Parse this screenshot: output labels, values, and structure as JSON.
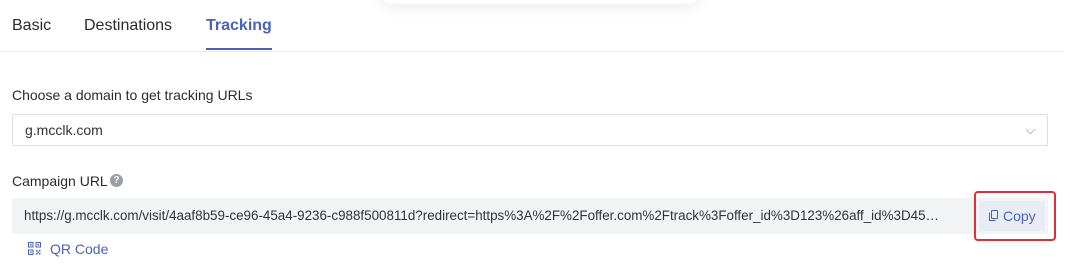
{
  "tabs": [
    {
      "label": "Basic",
      "active": false
    },
    {
      "label": "Destinations",
      "active": false
    },
    {
      "label": "Tracking",
      "active": true
    }
  ],
  "domain": {
    "label": "Choose a domain to get tracking URLs",
    "selected": "g.mcclk.com"
  },
  "campaign_url": {
    "label": "Campaign URL",
    "help_icon": "?",
    "value": "https://g.mcclk.com/visit/4aaf8b59-ce96-45a4-9236-c988f500811d?redirect=https%3A%2F%2Foffer.com%2Ftrack%3Foffer_id%3D123%26aff_id%3D45…",
    "copy_label": "Copy",
    "qr_label": "QR Code"
  },
  "colors": {
    "accent": "#4a63b8",
    "highlight": "#d9303a"
  }
}
